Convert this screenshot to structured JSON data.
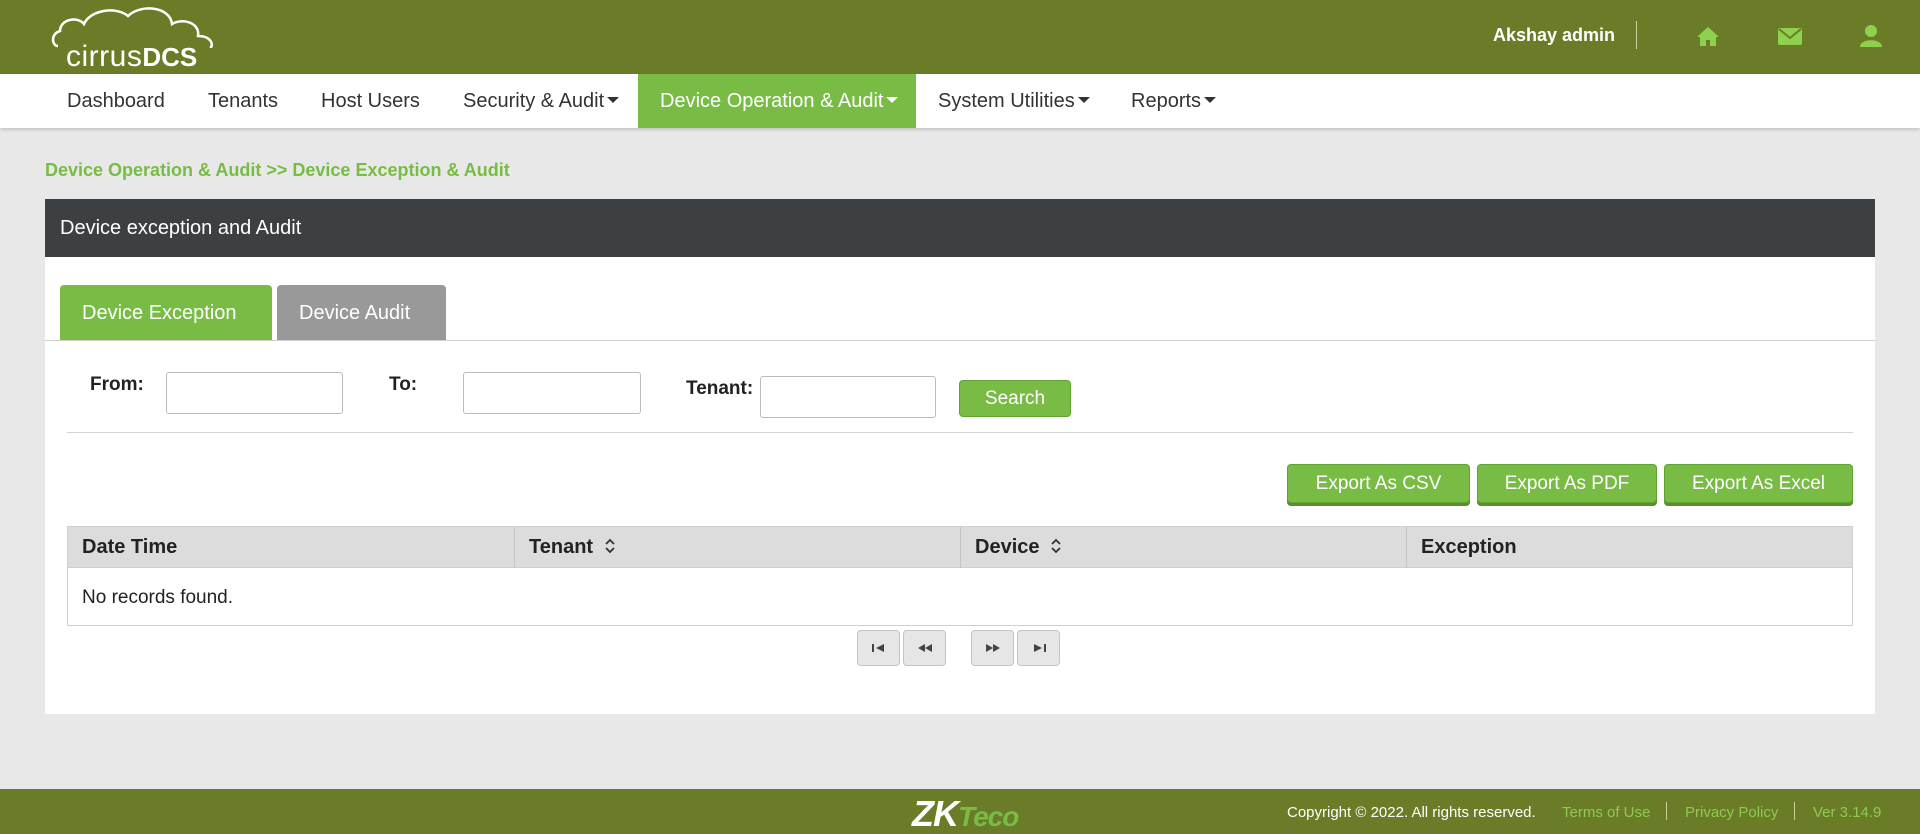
{
  "header": {
    "logo_text_light": "cirrus",
    "logo_text_bold": "DCS",
    "user_name": "Akshay admin",
    "icons": [
      "home-icon",
      "mail-icon",
      "user-icon"
    ],
    "accent_color": "#6b7c28"
  },
  "nav": {
    "items": [
      {
        "label": "Dashboard"
      },
      {
        "label": "Tenants"
      },
      {
        "label": "Host Users"
      },
      {
        "label": "Security & Audit"
      },
      {
        "label": "Device Operation & Audit"
      },
      {
        "label": "System Utilities"
      },
      {
        "label": "Reports"
      }
    ],
    "active_color": "#78bc45"
  },
  "breadcrumb": "Device Operation & Audit >> Device Exception & Audit",
  "panel": {
    "title": "Device exception and Audit",
    "tabs": [
      {
        "label": "Device Exception",
        "active": true
      },
      {
        "label": "Device Audit",
        "active": false
      }
    ]
  },
  "filters": {
    "from_label": "From:",
    "from_value": "",
    "to_label": "To:",
    "to_value": "",
    "tenant_label": "Tenant:",
    "tenant_value": "",
    "search_label": "Search"
  },
  "exports": {
    "csv": "Export As CSV",
    "pdf": "Export As PDF",
    "excel": "Export As Excel"
  },
  "table": {
    "columns": [
      "Date Time",
      "Tenant",
      "Device",
      "Exception"
    ],
    "empty_message": "No records found."
  },
  "footer": {
    "brand_main": "ZK",
    "brand_sub": "Teco",
    "copyright": "Copyright © 2022. All rights reserved.",
    "terms": "Terms of Use",
    "privacy": "Privacy Policy",
    "version": "Ver 3.14.9"
  }
}
